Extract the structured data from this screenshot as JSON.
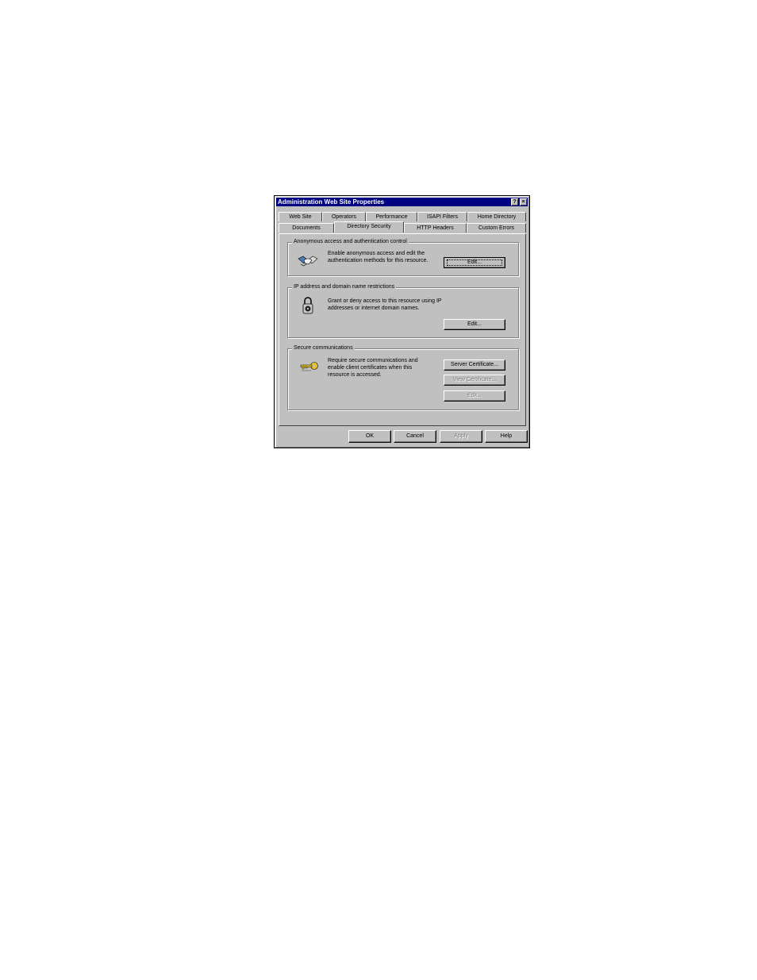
{
  "window": {
    "title": "Administration Web Site Properties",
    "help_glyph": "?",
    "close_glyph": "×"
  },
  "tabs": {
    "row_back": [
      "Web Site",
      "Operators",
      "Performance",
      "ISAPI Filters",
      "Home Directory"
    ],
    "row_front": [
      "Documents",
      "Directory Security",
      "HTTP Headers",
      "Custom Errors"
    ],
    "active": "Directory Security"
  },
  "groups": {
    "anonymous": {
      "legend": "Anonymous access and authentication control",
      "text": "Enable anonymous access and edit the authentication methods for this resource.",
      "icon": "handshake-icon",
      "edit_label": "Edit..."
    },
    "ip": {
      "legend": "IP address and domain name restrictions",
      "text": "Grant or deny access to this resource using IP addresses or internet domain names.",
      "icon": "padlock-icon",
      "edit_label": "Edit..."
    },
    "secure": {
      "legend": "Secure communications",
      "text": "Require secure communications and enable client certificates when this resource is accessed.",
      "icon": "keys-icon",
      "server_cert_label": "Server Certificate...",
      "view_cert_label": "View Certificate...",
      "edit_label": "Edit..."
    }
  },
  "buttons": {
    "ok": "OK",
    "cancel": "Cancel",
    "apply": "Apply",
    "help": "Help"
  }
}
